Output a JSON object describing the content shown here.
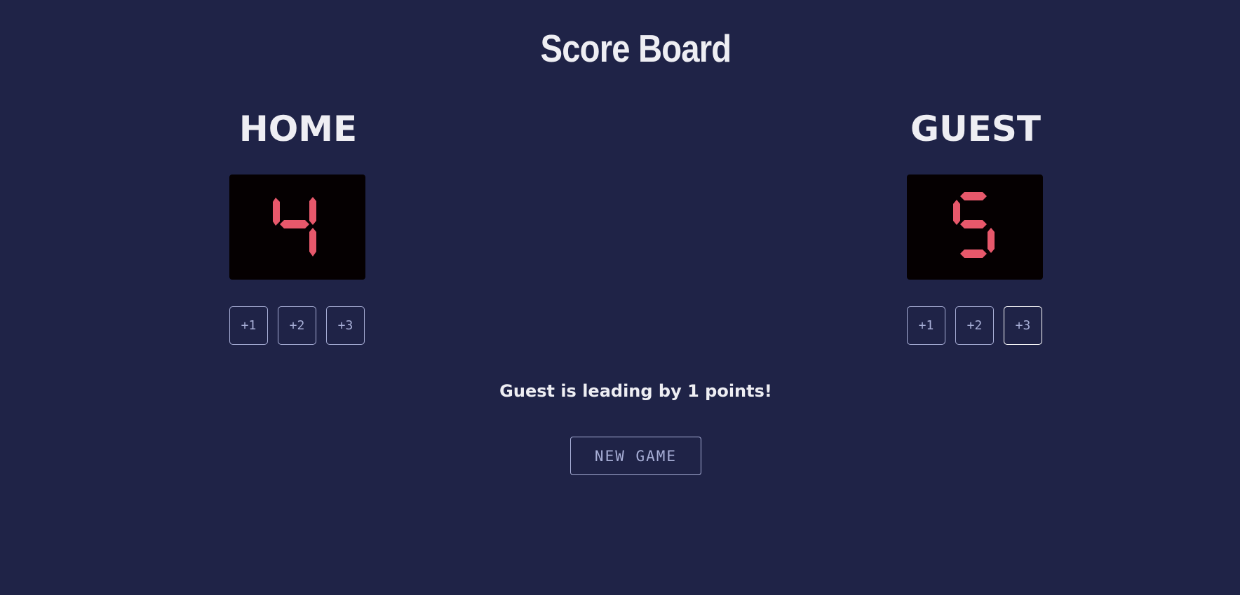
{
  "app": {
    "title": "Score Board"
  },
  "home": {
    "name": "HOME",
    "score": "4",
    "buttons": [
      "+1",
      "+2",
      "+3"
    ]
  },
  "guest": {
    "name": "GUEST",
    "score": "5",
    "buttons": [
      "+1",
      "+2",
      "+3"
    ]
  },
  "status": {
    "message": "Guest is leading by 1 points!"
  },
  "actions": {
    "new_game_label": "NEW GAME"
  },
  "colors": {
    "background": "#1f2347",
    "score_digit": "#e7586b",
    "score_box": "#050001",
    "button_outline": "#a7aed6",
    "text": "#eeeef3"
  }
}
